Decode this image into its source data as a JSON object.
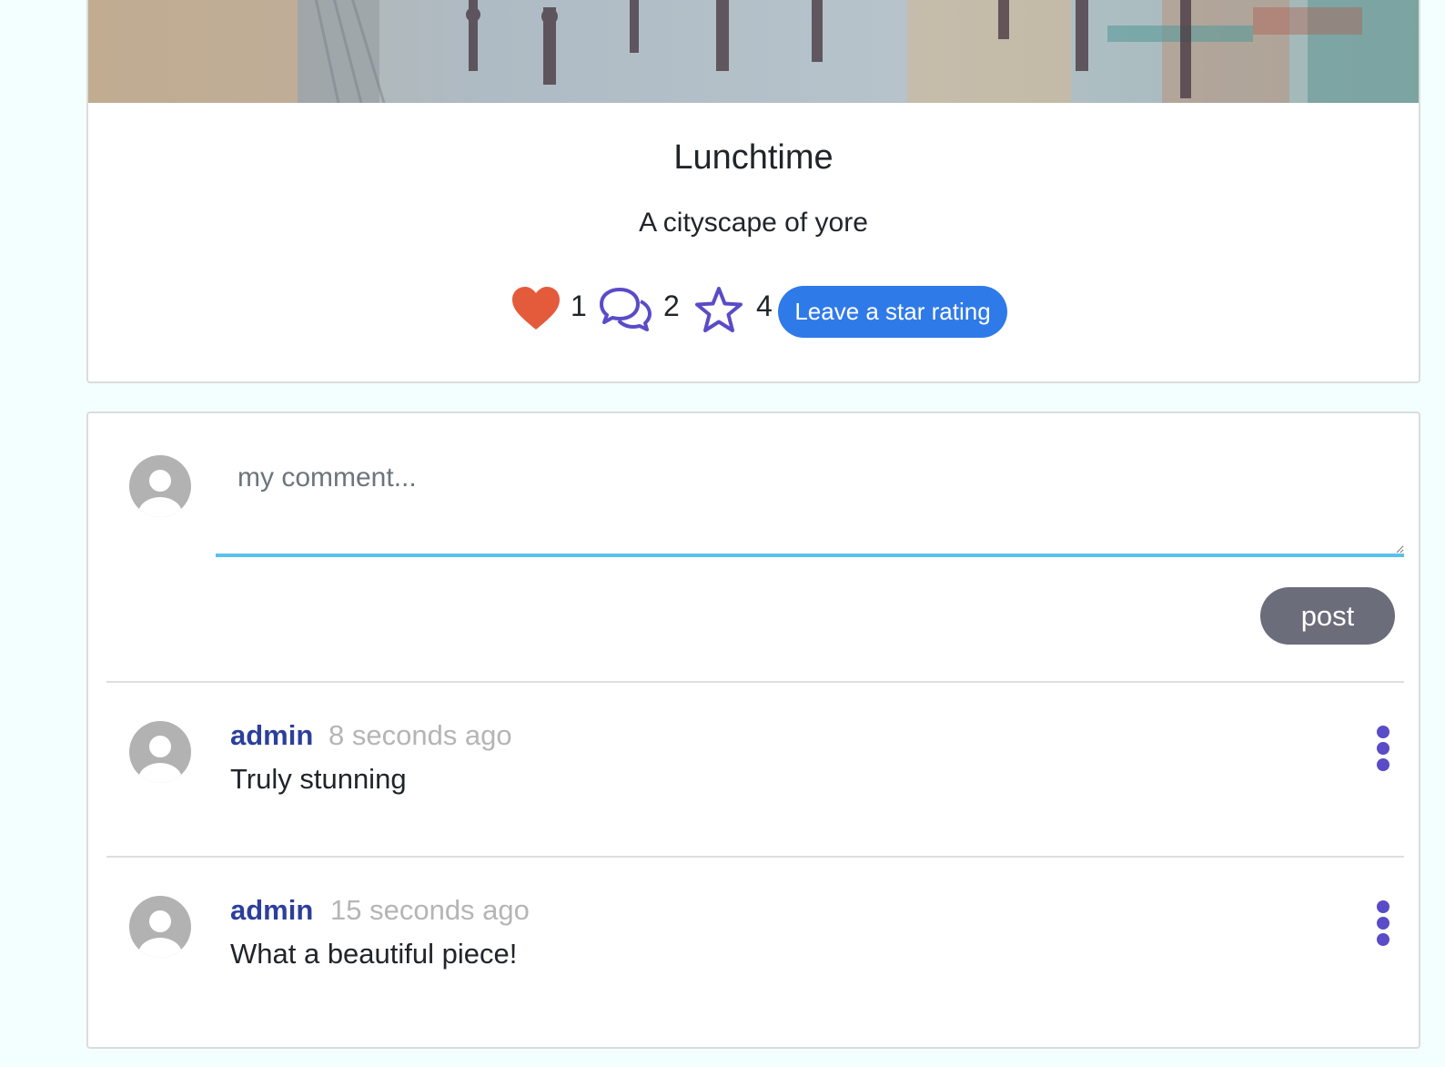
{
  "artwork": {
    "title": "Lunchtime",
    "subtitle": "A cityscape of yore",
    "likes": "1",
    "comments_count": "2",
    "rating": "4",
    "rate_label": "Leave a star rating",
    "icons": {
      "like": "heart-icon",
      "comments": "speech-bubbles-icon",
      "rating": "star-icon"
    }
  },
  "composer": {
    "placeholder": "my comment...",
    "post_label": "post"
  },
  "comments": [
    {
      "author": "admin",
      "time": "8 seconds ago",
      "text": "Truly stunning"
    },
    {
      "author": "admin",
      "time": "15 seconds ago",
      "text": "What a beautiful piece!"
    }
  ],
  "colors": {
    "page_bg": "#f3fffe",
    "accent_button": "#2f7ae9",
    "post_button": "#6c6d7a",
    "author": "#2c3f9c",
    "heart": "#e45b3c",
    "icon_purple": "#5a4bc7",
    "input_underline": "#5bc1ec"
  }
}
